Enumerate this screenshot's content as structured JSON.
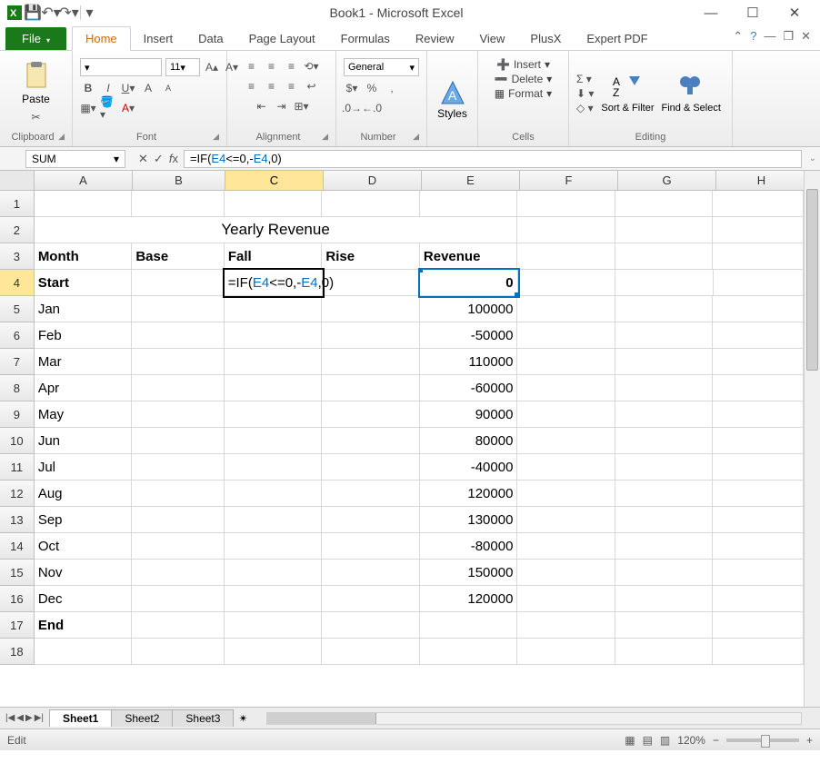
{
  "window": {
    "title": "Book1 - Microsoft Excel"
  },
  "qat": {
    "save": "💾",
    "undo": "↶",
    "redo": "↷"
  },
  "tabs": {
    "file": "File",
    "items": [
      "Home",
      "Insert",
      "Data",
      "Page Layout",
      "Formulas",
      "Review",
      "View",
      "PlusX",
      "Expert PDF"
    ],
    "active": "Home"
  },
  "ribbon": {
    "clipboard": {
      "label": "Clipboard",
      "paste": "Paste"
    },
    "font": {
      "label": "Font",
      "size": "11"
    },
    "alignment": {
      "label": "Alignment"
    },
    "number": {
      "label": "Number",
      "format": "General"
    },
    "styles": {
      "label": "Styles"
    },
    "cells": {
      "label": "Cells",
      "insert": "Insert",
      "delete": "Delete",
      "format": "Format"
    },
    "editing": {
      "label": "Editing",
      "sortfilter": "Sort & Filter",
      "findselect": "Find & Select"
    }
  },
  "formula": {
    "namebox": "SUM",
    "parts": {
      "pre": "=IF(",
      "ref1": "E4",
      "mid1": "<=0,-",
      "ref2": "E4",
      "mid2": ",0)"
    },
    "plain": "=IF(E4<=0,-E4,0)"
  },
  "grid": {
    "cols": [
      "A",
      "B",
      "C",
      "D",
      "E",
      "F",
      "G",
      "H"
    ],
    "activeCol": "C",
    "activeRow": 4,
    "refCell": "E4",
    "title": "Yearly Revenue",
    "headers": {
      "A": "Month",
      "B": "Base",
      "C": "Fall",
      "D": "Rise",
      "E": "Revenue"
    },
    "rows": [
      {
        "n": 4,
        "month": "Start",
        "rev": "0",
        "bold": true,
        "editing": true
      },
      {
        "n": 5,
        "month": "Jan",
        "rev": "100000"
      },
      {
        "n": 6,
        "month": "Feb",
        "rev": "-50000"
      },
      {
        "n": 7,
        "month": "Mar",
        "rev": "110000"
      },
      {
        "n": 8,
        "month": "Apr",
        "rev": "-60000"
      },
      {
        "n": 9,
        "month": "May",
        "rev": "90000"
      },
      {
        "n": 10,
        "month": "Jun",
        "rev": "80000"
      },
      {
        "n": 11,
        "month": "Jul",
        "rev": "-40000"
      },
      {
        "n": 12,
        "month": "Aug",
        "rev": "120000"
      },
      {
        "n": 13,
        "month": "Sep",
        "rev": "130000"
      },
      {
        "n": 14,
        "month": "Oct",
        "rev": "-80000"
      },
      {
        "n": 15,
        "month": "Nov",
        "rev": "150000"
      },
      {
        "n": 16,
        "month": "Dec",
        "rev": "120000"
      },
      {
        "n": 17,
        "month": "End",
        "rev": "",
        "bold": true
      },
      {
        "n": 18,
        "month": "",
        "rev": ""
      }
    ]
  },
  "sheets": {
    "items": [
      "Sheet1",
      "Sheet2",
      "Sheet3"
    ],
    "active": "Sheet1"
  },
  "status": {
    "mode": "Edit",
    "zoom": "120%"
  }
}
